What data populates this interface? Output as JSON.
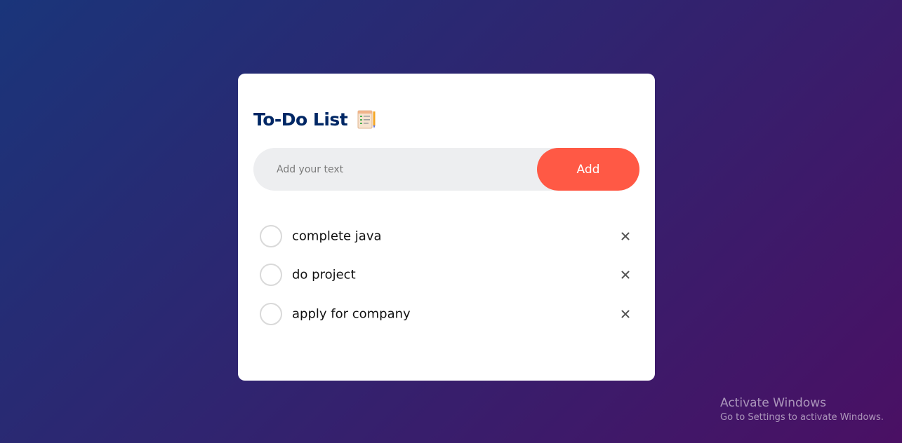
{
  "app": {
    "title": "To-Do List",
    "title_icon": "notepad-icon"
  },
  "input": {
    "placeholder": "Add your text",
    "value": ""
  },
  "add_button": {
    "label": "Add"
  },
  "tasks": [
    {
      "text": "complete java",
      "checked": false
    },
    {
      "text": "do project",
      "checked": false
    },
    {
      "text": "apply for company",
      "checked": false
    }
  ],
  "icons": {
    "check": "circle-checkbox-icon",
    "delete": "close-icon"
  },
  "colors": {
    "title": "#002765",
    "accent": "#ff5945",
    "input_bg": "#edeef0",
    "background_start": "#1a357a",
    "background_end": "#4a1064"
  },
  "watermark": {
    "title": "Activate Windows",
    "subtitle": "Go to Settings to activate Windows."
  }
}
